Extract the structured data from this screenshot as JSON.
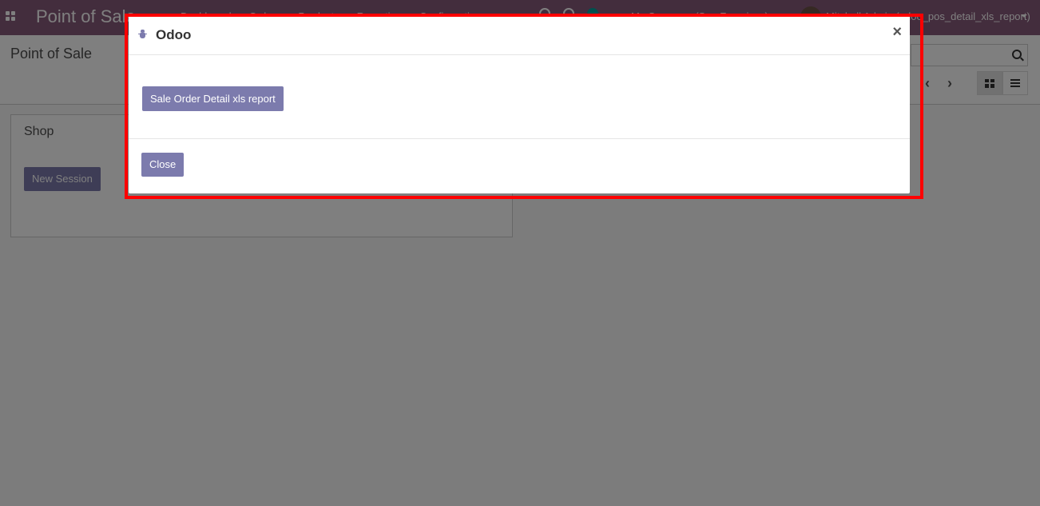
{
  "navbar": {
    "brand": "Point of Sale",
    "menu": [
      "Dashboard",
      "Orders",
      "Products",
      "Reporting",
      "Configuration"
    ],
    "company": "My Company (San Francisco)",
    "user": "Mitchell Admin (odoo_pos_detail_xls_report)"
  },
  "control_panel": {
    "breadcrumb": "Point of Sale",
    "pager_prev": "‹",
    "pager_next": "›"
  },
  "kanban": {
    "card_title": "Shop",
    "new_session_label": "New Session"
  },
  "dialog": {
    "title": "Odoo",
    "close_x": "×",
    "report_button": "Sale Order Detail xls report",
    "close_button": "Close"
  },
  "colors": {
    "navbar": "#875a7b",
    "primary_button": "#7c7bad",
    "highlight": "#ff0000"
  }
}
